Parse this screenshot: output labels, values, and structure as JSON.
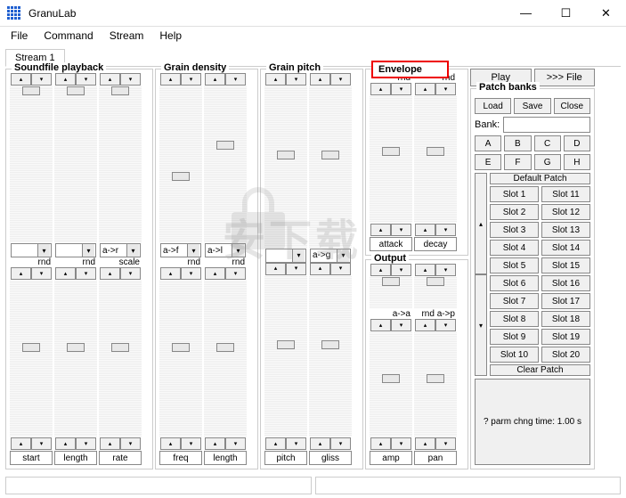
{
  "window": {
    "title": "GranuLab",
    "min": "—",
    "max": "☐",
    "close": "✕"
  },
  "menu": [
    "File",
    "Command",
    "Stream",
    "Help"
  ],
  "tab": "Stream 1",
  "groups": {
    "soundfile": {
      "title": "Soundfile playback",
      "labels": [
        "start",
        "length",
        "rate"
      ],
      "mid_combo": [
        "",
        "",
        "a->r"
      ],
      "mid_text": [
        "rnd",
        "rnd",
        "scale"
      ]
    },
    "density": {
      "title": "Grain density",
      "labels": [
        "freq",
        "length"
      ],
      "mid_combo": [
        "a->f",
        "a->l"
      ],
      "mid_text": [
        "rnd",
        "rnd"
      ]
    },
    "pitch": {
      "title": "Grain pitch",
      "labels": [
        "pitch",
        "gliss"
      ],
      "mid_combo": [
        "",
        "a->g"
      ],
      "mid_text": [
        "",
        ""
      ]
    },
    "envelope": {
      "title": "Envelope",
      "top_labels": [
        "rnd",
        "rnd"
      ],
      "btns": [
        "attack",
        "decay"
      ]
    },
    "output": {
      "title": "Output",
      "mid_text": [
        "a->a",
        "rnd a->p"
      ],
      "labels": [
        "amp",
        "pan"
      ]
    }
  },
  "right": {
    "play": "Play",
    "file": ">>> File",
    "patch_title": "Patch banks",
    "load": "Load",
    "save": "Save",
    "close": "Close",
    "bank_label": "Bank:",
    "letters": [
      "A",
      "B",
      "C",
      "D",
      "E",
      "F",
      "G",
      "H"
    ],
    "default": "Default Patch",
    "slots_l": [
      "Slot 1",
      "Slot 2",
      "Slot 3",
      "Slot 4",
      "Slot 5",
      "Slot 6",
      "Slot 7",
      "Slot 8",
      "Slot 9",
      "Slot 10"
    ],
    "slots_r": [
      "Slot 11",
      "Slot 12",
      "Slot 13",
      "Slot 14",
      "Slot 15",
      "Slot 16",
      "Slot 17",
      "Slot 18",
      "Slot 19",
      "Slot 20"
    ],
    "clear": "Clear Patch",
    "parm": "? parm chng time: 1.00 s"
  },
  "watermark": "安下载"
}
